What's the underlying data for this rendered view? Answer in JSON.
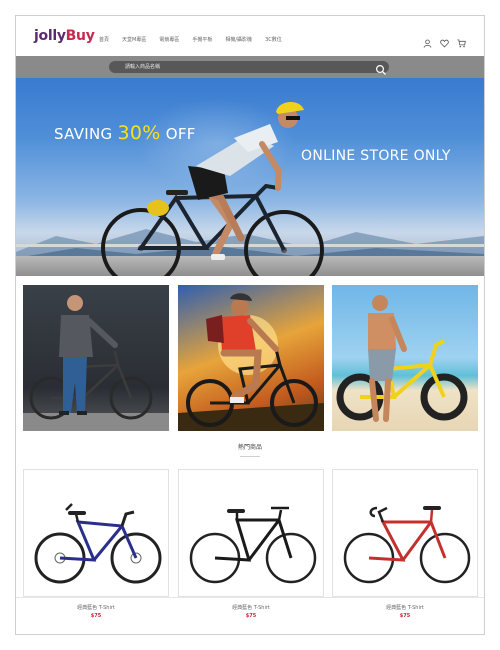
{
  "brand": {
    "name_part1": "jolly",
    "name_part2": "Buy"
  },
  "nav": [
    "首頁",
    "天堂M專區",
    "電競專區",
    "手機平板",
    "相機/攝影機",
    "3C數位"
  ],
  "search": {
    "placeholder": "請輸入商品名稱"
  },
  "header_icons": [
    "user-icon",
    "heart-icon",
    "cart-icon"
  ],
  "hero": {
    "saving_prefix": "SAVING ",
    "saving_highlight": "30%",
    "saving_suffix": " OFF",
    "tagline": "ONLINE STORE ONLY"
  },
  "section": {
    "title": "熱門商品"
  },
  "products": [
    {
      "name": "經典藍色 T-Shirt",
      "price": "$75"
    },
    {
      "name": "經典藍色 T-Shirt",
      "price": "$75"
    },
    {
      "name": "經典藍色 T-Shirt",
      "price": "$75"
    }
  ],
  "colors": {
    "brand_purple": "#5a2a6e",
    "brand_red": "#c62a4e",
    "price_red": "#d1203a",
    "search_bar": "#8a8a8a",
    "highlight_yellow": "#f4e21c"
  }
}
